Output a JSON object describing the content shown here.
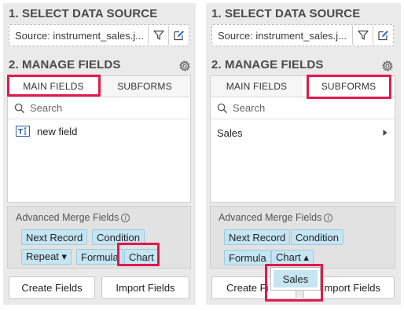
{
  "left": {
    "select_title": "1. SELECT DATA SOURCE",
    "source_text": "Source:  instrument_sales.j...",
    "manage_title": "2. MANAGE FIELDS",
    "tabs": [
      "MAIN FIELDS",
      "SUBFORMS"
    ],
    "search_placeholder": "Search",
    "field": "new field",
    "merge_title": "Advanced Merge Fields",
    "merge_chips": [
      "Next Record",
      "Condition",
      "Repeat ▾",
      "Formula",
      "Chart"
    ],
    "buttons": [
      "Create Fields",
      "Import Fields"
    ]
  },
  "right": {
    "select_title": "1. SELECT DATA SOURCE",
    "source_text": "Source:  instrument_sales.j...",
    "manage_title": "2. MANAGE FIELDS",
    "tabs": [
      "MAIN FIELDS",
      "SUBFORMS"
    ],
    "search_placeholder": "Search",
    "subform": "Sales",
    "merge_title": "Advanced Merge Fields",
    "merge_chips": [
      "Next Record",
      "Condition",
      "Formula",
      "Chart ▴"
    ],
    "dropdown_item": "Sales",
    "buttons": [
      "Create Fi",
      "mport Fields"
    ]
  },
  "colors": {
    "panel_bg": "#eaeaea",
    "chip_bg": "#c6e5f2",
    "highlight": "#e0194e"
  },
  "icons": {
    "filter": "filter-icon",
    "edit": "edit-icon",
    "settings": "gear-icon",
    "search": "search-icon",
    "field": "text-field-icon",
    "info": "info-icon",
    "expand": "chevron-right-icon"
  }
}
